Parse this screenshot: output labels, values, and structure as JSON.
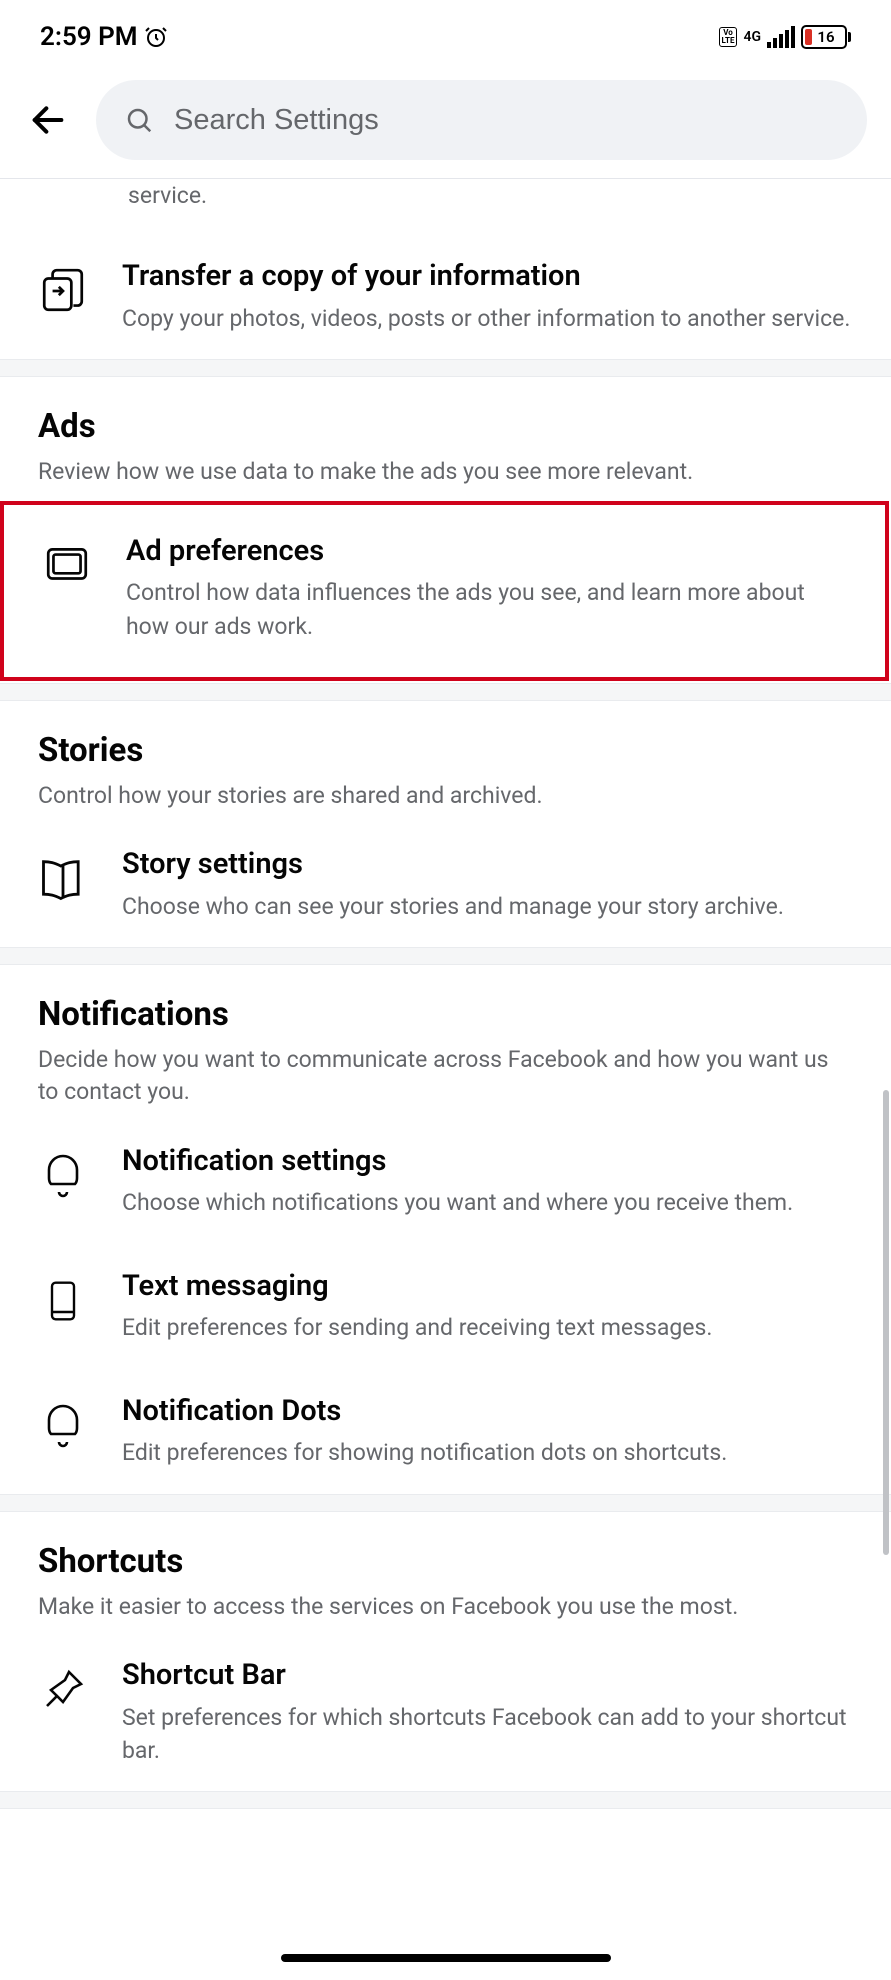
{
  "status": {
    "time": "2:59 PM",
    "network_type": "4G",
    "volte": "Vo LTE",
    "battery_pct": "16"
  },
  "search": {
    "placeholder": "Search Settings"
  },
  "partial_top": {
    "trailing": "service."
  },
  "items": {
    "transfer": {
      "title": "Transfer a copy of your information",
      "sub": "Copy your photos, videos, posts or other information to another service."
    },
    "ad_pref": {
      "title": "Ad preferences",
      "sub": "Control how data influences the ads you see, and learn more about how our ads work."
    },
    "story_settings": {
      "title": "Story settings",
      "sub": "Choose who can see your stories and manage your story archive."
    },
    "notif_settings": {
      "title": "Notification settings",
      "sub": "Choose which notifications you want and where you receive them."
    },
    "text_msg": {
      "title": "Text messaging",
      "sub": "Edit preferences for sending and receiving text messages."
    },
    "notif_dots": {
      "title": "Notification Dots",
      "sub": "Edit preferences for showing notification dots on shortcuts."
    },
    "shortcut_bar": {
      "title": "Shortcut Bar",
      "sub": "Set preferences for which shortcuts Facebook can add to your shortcut bar."
    }
  },
  "sections": {
    "ads": {
      "title": "Ads",
      "sub": "Review how we use data to make the ads you see more relevant."
    },
    "stories": {
      "title": "Stories",
      "sub": "Control how your stories are shared and archived."
    },
    "notifications": {
      "title": "Notifications",
      "sub": "Decide how you want to communicate across Facebook and how you want us to contact you."
    },
    "shortcuts": {
      "title": "Shortcuts",
      "sub": "Make it easier to access the services on Facebook you use the most."
    }
  }
}
